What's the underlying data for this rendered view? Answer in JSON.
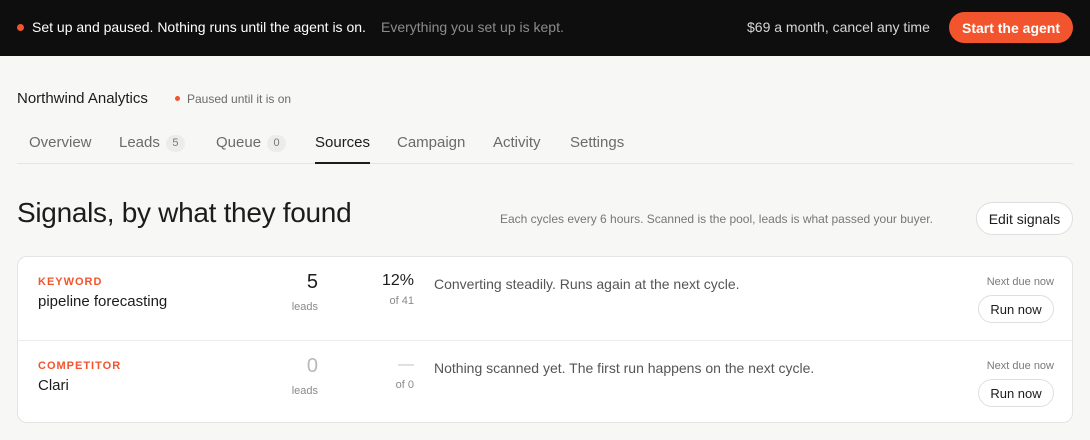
{
  "banner": {
    "message": "Set up and paused. Nothing runs until the agent is on.",
    "sub": "Everything you set up is kept.",
    "price": "$69 a month, cancel any time",
    "cta": "Start the agent",
    "status_color": "#f2542d"
  },
  "header": {
    "company": "Northwind Analytics",
    "status": "Paused until it is on"
  },
  "tabs": [
    {
      "label": "Overview"
    },
    {
      "label": "Leads",
      "count": "5"
    },
    {
      "label": "Queue",
      "count": "0"
    },
    {
      "label": "Sources",
      "active": true
    },
    {
      "label": "Campaign"
    },
    {
      "label": "Activity"
    },
    {
      "label": "Settings"
    }
  ],
  "section": {
    "title": "Signals, by what they found",
    "note": "Each cycles every 6 hours. Scanned is the pool, leads is what passed your buyer.",
    "edit_label": "Edit signals"
  },
  "signals": [
    {
      "kind": "KEYWORD",
      "name": "pipeline forecasting",
      "leads": "5",
      "leads_label": "leads",
      "pct": "12%",
      "of": "of 41",
      "desc": "Converting steadily. Runs again at the next cycle.",
      "due": "Next due now",
      "run_label": "Run now"
    },
    {
      "kind": "COMPETITOR",
      "name": "Clari",
      "leads": "0",
      "leads_label": "leads",
      "pct": "—",
      "of": "of 0",
      "desc": "Nothing scanned yet. The first run happens on the next cycle.",
      "due": "Next due now",
      "run_label": "Run now"
    }
  ],
  "colors": {
    "accent": "#f2542d",
    "banner_bg": "#0e0e0e",
    "page_bg": "#f7f7f6"
  }
}
